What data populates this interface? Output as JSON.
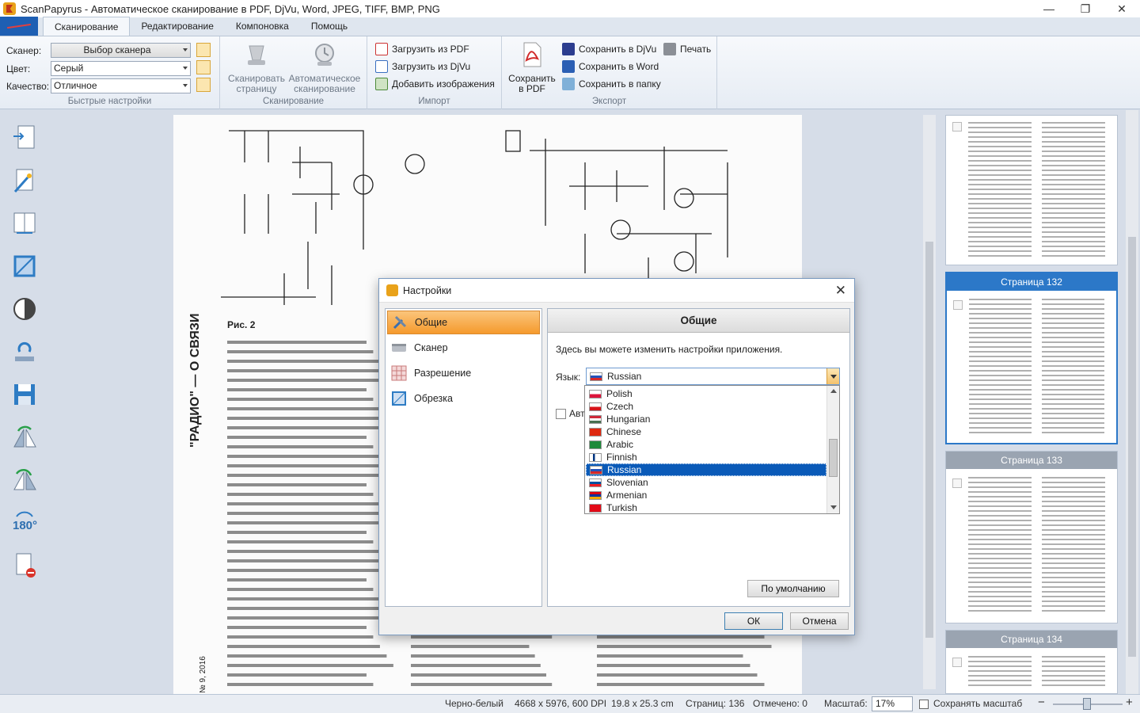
{
  "window": {
    "title": "ScanPapyrus - Автоматическое сканирование в PDF, DjVu, Word, JPEG, TIFF, BMP, PNG",
    "min": "—",
    "max": "❐",
    "close": "✕"
  },
  "tabs": [
    "Сканирование",
    "Редактирование",
    "Компоновка",
    "Помощь"
  ],
  "ribbon": {
    "quick": {
      "scanner_label": "Сканер:",
      "scanner_value": "Выбор сканера",
      "color_label": "Цвет:",
      "color_value": "Серый",
      "quality_label": "Качество:",
      "quality_value": "Отличное",
      "group_label": "Быстрые настройки"
    },
    "scan": {
      "scan_page_label": "Сканировать страницу",
      "auto_scan_label": "Автоматическое сканирование",
      "group_label": "Сканирование"
    },
    "import": {
      "load_pdf": "Загрузить из PDF",
      "load_djvu": "Загрузить из DjVu",
      "add_images": "Добавить изображения",
      "group_label": "Импорт"
    },
    "export": {
      "save_pdf": "Сохранить в PDF",
      "save_djvu": "Сохранить в DjVu",
      "save_word": "Сохранить в Word",
      "save_folder": "Сохранить в папку",
      "print": "Печать",
      "group_label": "Экспорт"
    }
  },
  "thumbnails": [
    {
      "label": ""
    },
    {
      "label": "Страница 132"
    },
    {
      "label": "Страница 133"
    },
    {
      "label": "Страница 134"
    }
  ],
  "document": {
    "side_heading": "\"РАДИО\" — О СВЯЗИ",
    "fig_caption": "Рис. 2",
    "issue": "№ 9, 2016"
  },
  "status": {
    "mode": "Черно-белый",
    "resolution": "4668 x 5976, 600 DPI",
    "size": "19.8 x 25.3 cm",
    "pages": "Страниц: 136",
    "marked": "Отмечено: 0",
    "zoom_label": "Масштаб:",
    "zoom_value": "17%",
    "keep_zoom": "Сохранять масштаб",
    "zoom_out": "−",
    "zoom_in": "+"
  },
  "dialog": {
    "title": "Настройки",
    "close": "✕",
    "nav": [
      {
        "label": "Общие"
      },
      {
        "label": "Сканер"
      },
      {
        "label": "Разрешение"
      },
      {
        "label": "Обрезка"
      }
    ],
    "header": "Общие",
    "description": "Здесь вы можете изменить настройки приложения.",
    "language_label": "Язык:",
    "language_value": "Russian",
    "auto_partial": "Авт",
    "languages": [
      "Polish",
      "Czech",
      "Hungarian",
      "Chinese",
      "Arabic",
      "Finnish",
      "Russian",
      "Slovenian",
      "Armenian",
      "Turkish"
    ],
    "selected_language_index": 6,
    "default_button": "По умолчанию",
    "ok_button": "ОК",
    "cancel_button": "Отмена"
  },
  "colors": {
    "accent_blue": "#2c78c8",
    "nav_active": "#f59a2d",
    "selection": "#0a5ab8"
  }
}
